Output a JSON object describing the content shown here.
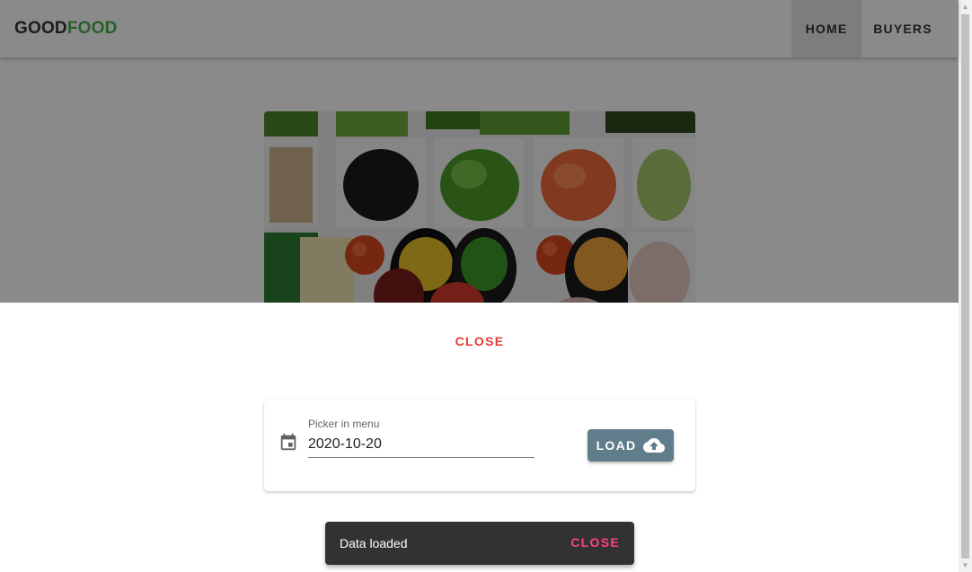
{
  "brand": {
    "part1": "GOOD",
    "part2": "FOOD"
  },
  "nav": {
    "home": "HOME",
    "buyers": "BUYERS",
    "active": "HOME"
  },
  "hero": {
    "icon": "salad-photo"
  },
  "sheet": {
    "close_label": "CLOSE",
    "picker": {
      "label": "Picker in menu",
      "value": "2020-10-20",
      "icon": "calendar-icon"
    },
    "load_label": "LOAD",
    "load_icon": "cloud-upload-icon"
  },
  "snackbar": {
    "message": "Data loaded",
    "close_label": "CLOSE"
  },
  "colors": {
    "brand_dark": "#333333",
    "brand_green": "#4caf50",
    "sheet_close": "#e53935",
    "load_button": "#607d8b",
    "snackbar_bg": "#323232",
    "snackbar_action": "#ff4081"
  }
}
